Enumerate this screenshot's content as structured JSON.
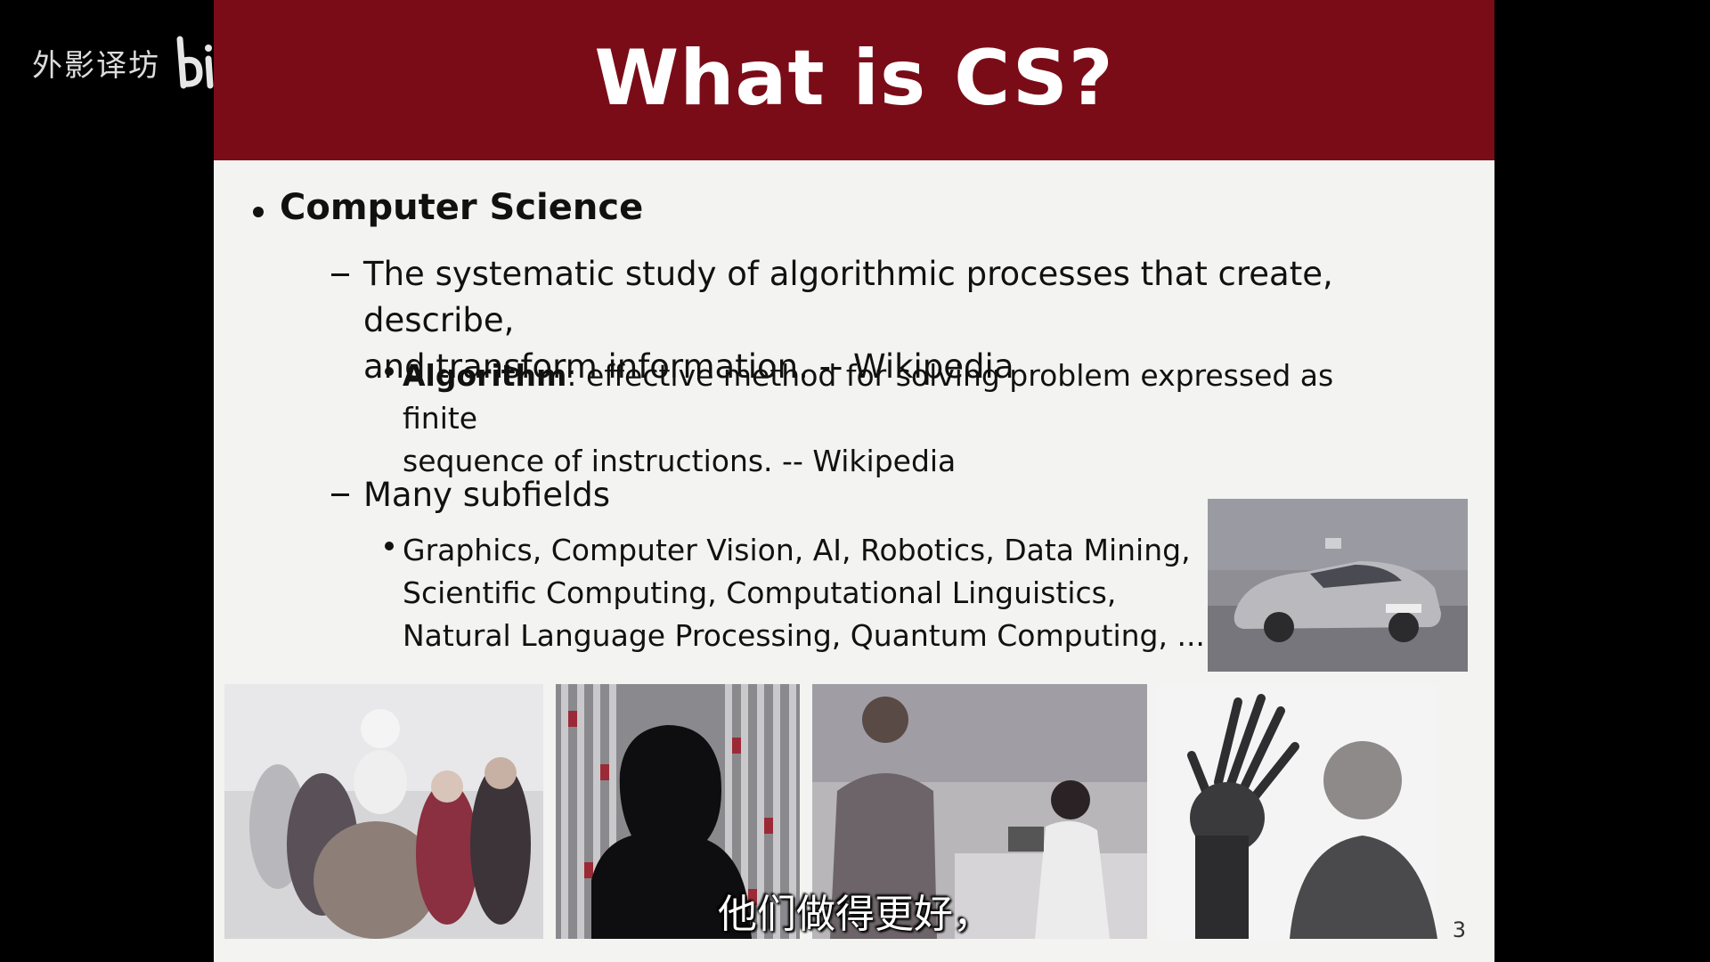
{
  "watermark": {
    "text": "外影译坊",
    "logo": "bilibili"
  },
  "slide": {
    "title": "What is CS?",
    "page_number": "3",
    "bullets": {
      "main": "Computer Science",
      "definition_line1": "The systematic study of algorithmic processes that create, describe,",
      "definition_line2": "and transform information.  -- Wikipedia",
      "algorithm_term": "Algorithm",
      "algorithm_line1_rest": ": effective method for solving problem expressed as finite",
      "algorithm_line2": "sequence of instructions.  -- Wikipedia",
      "subfields_heading": "Many subfields",
      "subfields_line1": "Graphics, Computer Vision, AI, Robotics, Data Mining,",
      "subfields_line2": "Scientific Computing, Computational Linguistics,",
      "subfields_line3": "Natural Language Processing, Quantum Computing,  ..."
    },
    "images": [
      "self-driving-car-image",
      "animated-characters-image",
      "dna-silhouette-image",
      "people-working-image",
      "robotic-hand-image"
    ],
    "colors": {
      "title_bar": "#7a0c18",
      "slide_bg": "#f3f3f1"
    }
  },
  "subtitle": "他们做得更好，"
}
